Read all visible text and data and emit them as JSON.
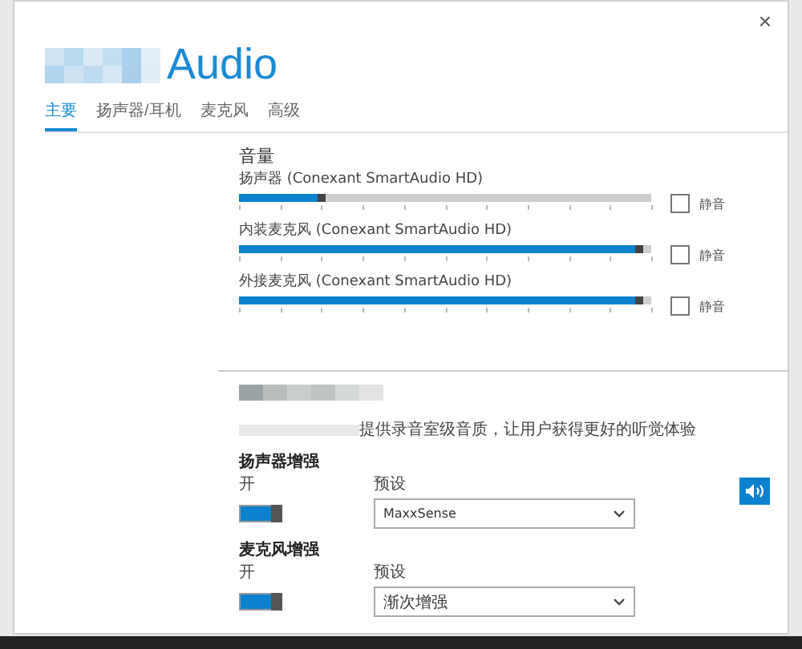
{
  "window": {
    "close": "×"
  },
  "header": {
    "title": "Audio"
  },
  "tabs": [
    {
      "label": "主要",
      "selected": true
    },
    {
      "label": "扬声器/耳机",
      "selected": false
    },
    {
      "label": "麦克风",
      "selected": false
    },
    {
      "label": "高级",
      "selected": false
    }
  ],
  "volume": {
    "heading": "音量",
    "channels": [
      {
        "name": "扬声器 (Conexant SmartAudio HD)",
        "level": 0.21,
        "muted": false,
        "mute_label": "静音"
      },
      {
        "name": "内装麦克风 (Conexant SmartAudio HD)",
        "level": 0.98,
        "muted": false,
        "mute_label": "静音"
      },
      {
        "name": "外接麦克风 (Conexant SmartAudio HD)",
        "level": 0.98,
        "muted": false,
        "mute_label": "静音"
      }
    ]
  },
  "enhancement": {
    "description": "提供录音室级音质，让用户获得更好的听觉体验",
    "groups": [
      {
        "title": "扬声器增强",
        "switch_label": "开",
        "on": true,
        "preset_label": "预设",
        "preset": "MaxxSense"
      },
      {
        "title": "麦克风增强",
        "switch_label": "开",
        "on": true,
        "preset_label": "预设",
        "preset": "渐次增强"
      }
    ]
  }
}
